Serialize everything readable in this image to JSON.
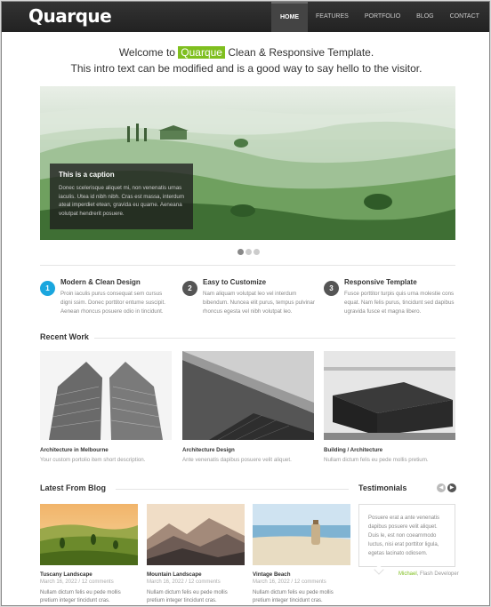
{
  "site": {
    "logo": "Quarque"
  },
  "nav": [
    "HOME",
    "FEATURES",
    "PORTFOLIO",
    "BLOG",
    "CONTACT"
  ],
  "intro": {
    "prefix": "Welcome to ",
    "highlight": "Quarque",
    "suffix": " Clean & Responsive Template.",
    "line2": "This intro text can be modified and is a good way to say hello to the visitor."
  },
  "slider": {
    "caption_title": "This is a caption",
    "caption_text": "Donec scelerisque aliquet mi, non venenatis urnas iaculis. Utea id nibh nibh. Cras est massa, interdum ateal imperdiet etean, gravida eu quame. Aeneana volutpat hendrerit posuere.",
    "slides": 3,
    "active_slide": 1
  },
  "features": [
    {
      "num": "1",
      "title": "Modern & Clean Design",
      "text": "Proin iaculis purus consequat sem cursus digni ssim. Donec porttitor entume suscipit. Aenean rhoncus posuere odio in tincidunt."
    },
    {
      "num": "2",
      "title": "Easy to Customize",
      "text": "Nam aliquam volutpat leo vel interdum bibendum. Nunceа elit purus, tempus pulvinar rhoncus egesta vel nibh volutpat leo."
    },
    {
      "num": "3",
      "title": "Responsive Template",
      "text": "Fusce porttitor turpis quis urna molestie cons equat. Nam felis purus, tincidunt sed dapibus ugravida fusce et magna libero."
    }
  ],
  "recent_work": {
    "title": "Recent Work",
    "items": [
      {
        "title": "Architecture in Melbourne",
        "desc": "Your custom portolio item short description."
      },
      {
        "title": "Architecture Design",
        "desc": "Ante venenatis dapibus posuere velit aliquet."
      },
      {
        "title": "Building / Architecture",
        "desc": "Nullam dictum felis eu pede mollis pretium."
      }
    ]
  },
  "blog": {
    "title": "Latest From Blog",
    "posts": [
      {
        "title": "Tuscany Landscape",
        "meta": "March 16, 2022 / 12 comments",
        "text": "Nullam dictum felis eu pede mollis pretium integer tincidunt cras."
      },
      {
        "title": "Mountain Landscape",
        "meta": "March 16, 2022 / 12 comments",
        "text": "Nullam dictum felis eu pede mollis pretium integer tincidunt cras."
      },
      {
        "title": "Vintage Beach",
        "meta": "March 16, 2022 / 12 comments",
        "text": "Nullam dictum felis eu pede mollis pretium integer tincidunt cras."
      }
    ]
  },
  "testimonials": {
    "title": "Testimonials",
    "text": "Posuere erat a ante venenatis dapibus posuere velit aliquet. Duis le, est non coearnmodo luctus, nisi erat porttitor ligula, egetas lacinato odiosem.",
    "author": "Michael",
    "role": ", Flash Developer"
  },
  "colors": {
    "accent": "#7fbf1f",
    "blue": "#1aa6de",
    "topbar": "#2b2b2b"
  },
  "icons": {
    "prev": "chevron-left-icon",
    "next": "chevron-right-icon"
  }
}
